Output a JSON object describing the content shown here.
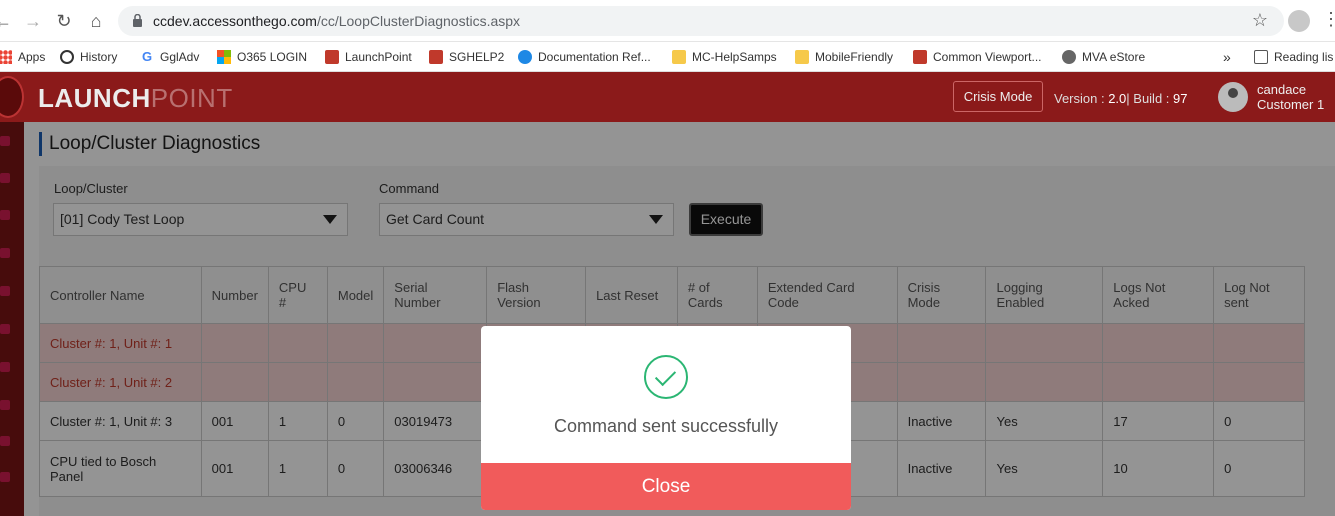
{
  "browser": {
    "url_host": "ccdev.accessonthego.com",
    "url_path": "/cc/LoopClusterDiagnostics.aspx",
    "bookmarks": [
      {
        "label": "Apps",
        "icon": "apps-icon"
      },
      {
        "label": "History",
        "icon": "history-icon"
      },
      {
        "label": "GglAdv",
        "icon": "google-icon"
      },
      {
        "label": "O365 LOGIN",
        "icon": "microsoft-icon"
      },
      {
        "label": "LaunchPoint",
        "icon": "launchpoint-icon"
      },
      {
        "label": "SGHELP2",
        "icon": "sghelp-icon"
      },
      {
        "label": "Documentation Ref...",
        "icon": "documentation-icon"
      },
      {
        "label": "MC-HelpSamps",
        "icon": "folder-icon"
      },
      {
        "label": "MobileFriendly",
        "icon": "folder-icon"
      },
      {
        "label": "Common Viewport...",
        "icon": "viewport-icon"
      },
      {
        "label": "MVA eStore",
        "icon": "globe-icon"
      }
    ],
    "overflow": "»",
    "reading_list": "Reading lis"
  },
  "header": {
    "brand_bold": "LAUNCH",
    "brand_light": "POINT",
    "crisis_mode_label": "Crisis Mode",
    "version_label": "Version : ",
    "version_value": "2.0",
    "build_label": "| Build : ",
    "build_value": "97",
    "user_line1": "candace",
    "user_line2": "Customer 1"
  },
  "page": {
    "title": "Loop/Cluster Diagnostics",
    "loop_label": "Loop/Cluster",
    "loop_value": "[01] Cody Test Loop",
    "command_label": "Command",
    "command_value": "Get Card Count",
    "execute_label": "Execute"
  },
  "table": {
    "headers": [
      "Controller Name",
      "Number",
      "CPU #",
      "Model",
      "Serial Number",
      "Flash Version",
      "Last Reset",
      "# of Cards",
      "Extended Card Code",
      "Crisis Mode",
      "Logging Enabled",
      "Logs Not Acked",
      "Log Not sent"
    ],
    "rows": [
      {
        "status": "error",
        "cells": [
          "Cluster #: 1, Unit #: 1",
          "",
          "",
          "",
          "",
          "",
          "",
          "",
          "",
          "",
          "",
          "",
          ""
        ]
      },
      {
        "status": "error",
        "cells": [
          "Cluster #: 1, Unit #: 2",
          "",
          "",
          "",
          "",
          "",
          "",
          "",
          "",
          "",
          "",
          "",
          ""
        ]
      },
      {
        "status": "ok",
        "cells": [
          "Cluster #: 1, Unit #: 3",
          "001",
          "1",
          "0",
          "03019473",
          "",
          "",
          "",
          "",
          "Inactive",
          "Yes",
          "17",
          "0"
        ]
      },
      {
        "status": "ok",
        "cells": [
          "CPU tied to Bosch Panel",
          "001",
          "1",
          "0",
          "03006346",
          "",
          "",
          "",
          "",
          "Inactive",
          "Yes",
          "10",
          "0"
        ]
      }
    ]
  },
  "modal": {
    "message": "Command sent successfully",
    "close_label": "Close"
  },
  "colors": {
    "brand": "#8b1a1a",
    "success": "#2bb673",
    "close_button": "#f15b5b",
    "error_row": "#f6d4d4"
  }
}
